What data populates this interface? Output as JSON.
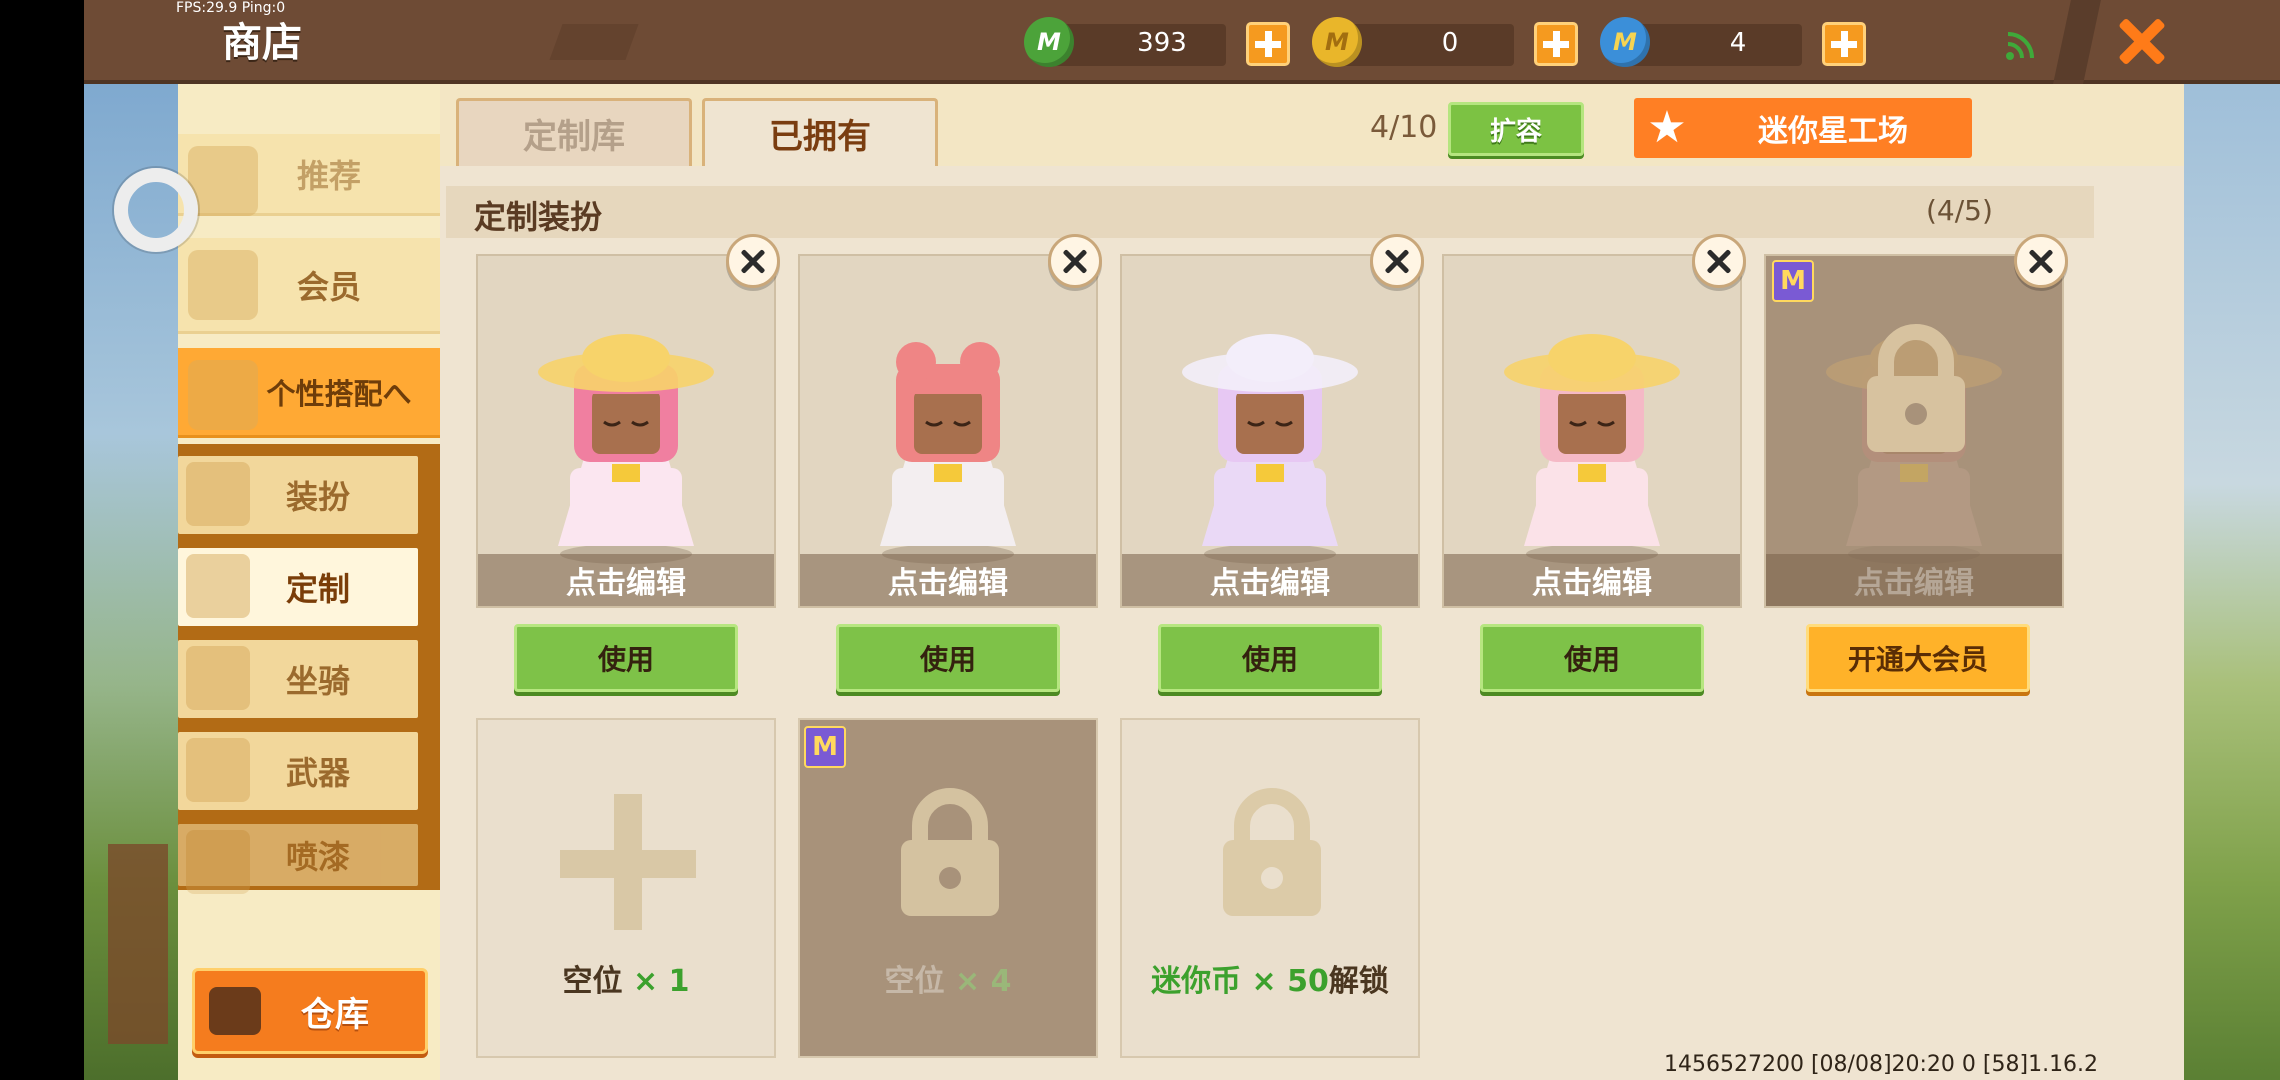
{
  "debug": {
    "fps_ping": "FPS:29.9  Ping:0"
  },
  "header": {
    "title": "商店"
  },
  "currencies": [
    {
      "icon": "mini-bean-icon",
      "value": "393",
      "color": "#4ca33a"
    },
    {
      "icon": "mini-coin-icon",
      "value": "0",
      "color": "#e9b62a"
    },
    {
      "icon": "star-coin-icon",
      "value": "4",
      "color": "#3b8fd9"
    }
  ],
  "coin_glyph": "M",
  "sidebar": {
    "items": [
      {
        "label": "推荐"
      },
      {
        "label": "会员"
      },
      {
        "label": "个性搭配へ"
      }
    ],
    "sub_items": [
      {
        "label": "装扮"
      },
      {
        "label": "定制"
      },
      {
        "label": "坐骑"
      },
      {
        "label": "武器"
      },
      {
        "label": "喷漆"
      }
    ],
    "warehouse_label": "仓库"
  },
  "tabs": [
    {
      "label": "定制库"
    },
    {
      "label": "已拥有"
    }
  ],
  "capacity": {
    "text": "4/10",
    "expand_label": "扩容"
  },
  "workshop_label": "迷你星工场",
  "section": {
    "title": "定制装扮",
    "count": "(4/5)"
  },
  "outfits": [
    {
      "caption": "点击编辑",
      "button": "使用",
      "hair": "#f07fa0",
      "hat": "#f7d36a",
      "dress": "#fbe6f0"
    },
    {
      "caption": "点击编辑",
      "button": "使用",
      "hair": "#ef8585",
      "hat": "",
      "dress": "#f3eef0"
    },
    {
      "caption": "点击编辑",
      "button": "使用",
      "hair": "#e7c8f3",
      "hat": "#f3eefa",
      "dress": "#ead9f6"
    },
    {
      "caption": "点击编辑",
      "button": "使用",
      "hair": "#f5b9c6",
      "hat": "#f7d36a",
      "dress": "#fbe2e8"
    },
    {
      "caption": "点击编辑",
      "button": "开通大会员",
      "hair": "#c98a7e",
      "hat": "#e0b46a",
      "dress": "#c9a696"
    }
  ],
  "badge_glyph": "M",
  "slots": [
    {
      "prefix": "空位 ",
      "highlight": "× 1",
      "suffix": ""
    },
    {
      "prefix": "空位 ",
      "highlight": "× 4",
      "suffix": ""
    },
    {
      "prefix": "",
      "highlight": "迷你币 × 50",
      "suffix": "解锁"
    }
  ],
  "footer": "1456527200   [08/08]20:20 0 [58]1.16.2"
}
